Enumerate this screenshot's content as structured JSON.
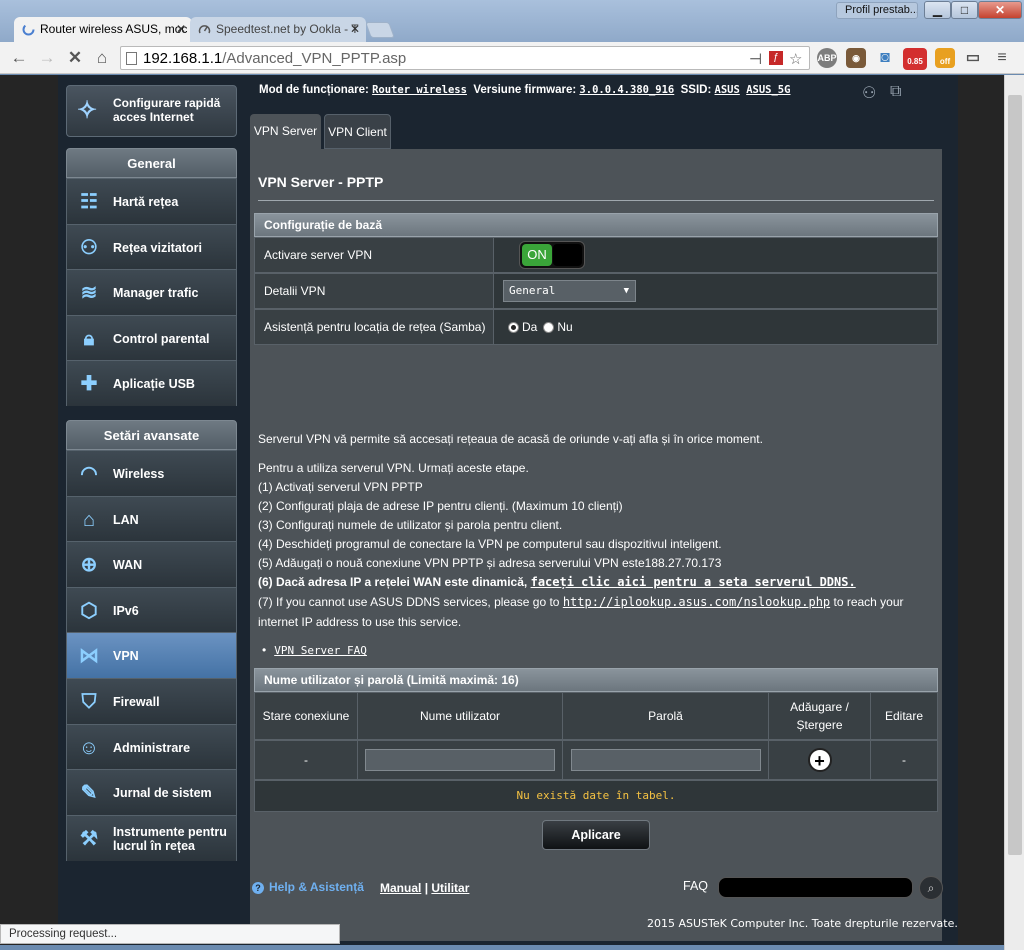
{
  "browser": {
    "tabs": [
      {
        "title": "Router wireless ASUS, moc",
        "close": "✕"
      },
      {
        "title": "Speedtest.net by Ookla - T",
        "close": "✕"
      }
    ],
    "profile": "Profil prestab...",
    "window_buttons": {
      "min": "▁",
      "max": "□",
      "close": "✕"
    },
    "url_host": "192.168.1.1",
    "url_path": "/Advanced_VPN_PPTP.asp",
    "extensions": {
      "abp": "ABP",
      "speed": "0.85",
      "off": "off"
    },
    "status": "Processing request..."
  },
  "router": {
    "quick_setup": "Configurare rapidă acces Internet",
    "general_header": "General",
    "general_items": [
      {
        "label": "Hartă rețea",
        "icon": "network-map-icon"
      },
      {
        "label": "Rețea vizitatori",
        "icon": "guest-network-icon"
      },
      {
        "label": "Manager trafic",
        "icon": "traffic-manager-icon"
      },
      {
        "label": "Control parental",
        "icon": "parental-lock-icon"
      },
      {
        "label": "Aplicație USB",
        "icon": "usb-puzzle-icon"
      }
    ],
    "advanced_header": "Setări avansate",
    "advanced_items": [
      {
        "label": "Wireless",
        "icon": "wireless-icon"
      },
      {
        "label": "LAN",
        "icon": "lan-home-icon"
      },
      {
        "label": "WAN",
        "icon": "wan-globe-icon"
      },
      {
        "label": "IPv6",
        "icon": "ipv6-icon"
      },
      {
        "label": "VPN",
        "icon": "vpn-icon"
      },
      {
        "label": "Firewall",
        "icon": "firewall-shield-icon"
      },
      {
        "label": "Administrare",
        "icon": "admin-user-icon"
      },
      {
        "label": "Jurnal de sistem",
        "icon": "system-log-icon"
      },
      {
        "label": "Instrumente pentru lucrul în rețea",
        "icon": "network-tools-icon"
      }
    ],
    "info": {
      "mode_label": "Mod de funcționare:",
      "mode_value": "Router wireless",
      "firmware_label": "Versiune firmware:",
      "firmware_value": "3.0.0.4.380_916",
      "ssid_label": "SSID:",
      "ssid_1": "ASUS",
      "ssid_2": "ASUS_5G"
    },
    "tabs": {
      "server": "VPN Server",
      "client": "VPN Client"
    },
    "panel_title": "VPN Server - PPTP",
    "basic_config": {
      "header": "Configurație de bază",
      "enable_label": "Activare server VPN",
      "enable_value": "ON",
      "details_label": "Detalii VPN",
      "details_value": "General",
      "samba_label": "Asistență pentru locația de rețea (Samba)",
      "samba_yes": "Da",
      "samba_no": "Nu"
    },
    "description": "Serverul VPN vă permite să accesați rețeaua de acasă de oriunde v-ați afla și în orice moment.",
    "steps_intro": "Pentru a utiliza serverul VPN. Urmați aceste etape.",
    "steps": [
      "(1) Activați serverul VPN PPTP",
      "(2) Configurați plaja de adrese IP pentru clienți. (Maximum 10 clienți)",
      "(3) Configurați numele de utilizator și parola pentru client.",
      "(4) Deschideți programul de conectare la VPN pe computerul sau dispozitivul inteligent.",
      "(5) Adăugați o nouă conexiune VPN PPTP și adresa serverului VPN este188.27.70.173"
    ],
    "step6_text": "(6) Dacă adresa IP a rețelei WAN este dinamică,",
    "step6_link": "faceți clic aici pentru a seta serverul DDNS.",
    "step7_pre": "(7) If you cannot use ASUS DDNS services, please go to",
    "step7_link": "http://iplookup.asus.com/nslookup.php",
    "step7_post": "to reach your",
    "step7_line2": "internet IP address to use this service.",
    "faq_bullet": "•",
    "faq_link": "VPN Server FAQ",
    "users": {
      "header": "Nume utilizator și parolă (Limită maximă: 16)",
      "col_status": "Stare conexiune",
      "col_user": "Nume utilizator",
      "col_pass": "Parolă",
      "col_add": "Adăugare / Ștergere",
      "col_edit": "Editare",
      "row_status": "-",
      "row_edit": "-",
      "add_symbol": "+",
      "empty": "Nu există date în tabel."
    },
    "apply": "Aplicare",
    "footer": {
      "help": "Help & Asistență",
      "manual": "Manual",
      "sep": "|",
      "utility": "Utilitar",
      "faq": "FAQ",
      "copyright": "2015 ASUSTeK Computer Inc. Toate drepturile rezervate."
    }
  }
}
